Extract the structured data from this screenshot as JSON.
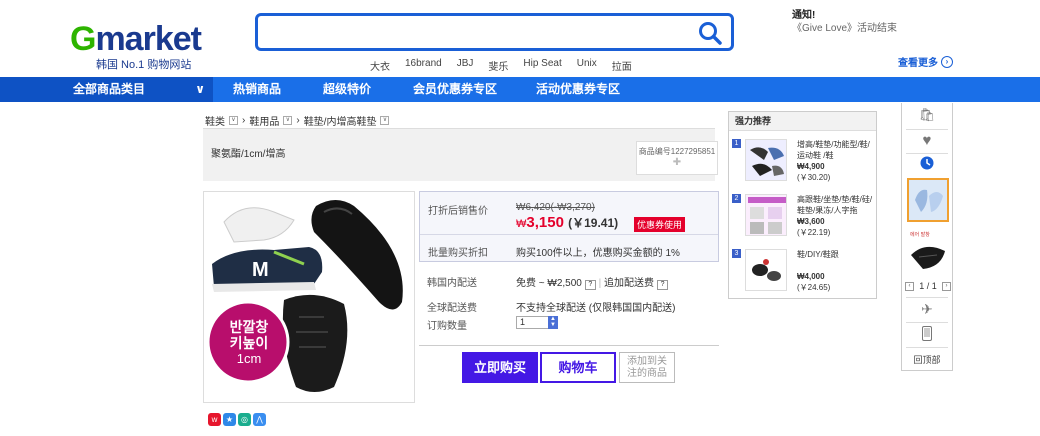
{
  "header": {
    "logo_g": "G",
    "logo_rest": "market",
    "logo_tag": "韩国 No.1 购物网站",
    "search_placeholder": "",
    "keywords": [
      "大衣",
      "16brand",
      "JBJ",
      "斐乐",
      "Hip Seat",
      "Unix",
      "拉面"
    ],
    "notice_title": "通知!",
    "notice_text": "《Give Love》活动结束",
    "more_label": "查看更多"
  },
  "nav": {
    "all_categories": "全部商品类目",
    "items": [
      "热销商品",
      "超级特价",
      "会员优惠券专区",
      "活动优惠券专区"
    ]
  },
  "breadcrumb": [
    "鞋类",
    "鞋用品",
    "鞋垫/内增高鞋垫"
  ],
  "product": {
    "title": "聚氨酯/1cm/增高",
    "code": "商品编号1227295851",
    "image_text_line1": "반깔창",
    "image_text_line2": "키높이",
    "image_text_line3": "1cm",
    "sale_label": "打折后销售价",
    "orig_price": "₩6,420(-₩3,270)",
    "price_w": "₩",
    "price": "3,150",
    "price_cny": "(￥19.41)",
    "coupon": "优惠券使用",
    "bulk_label": "批量购买折扣",
    "bulk_text": "购买100件以上，优惠购买金额的 1%",
    "domestic_label": "韩国内配送",
    "domestic_text": "免费 ~ ₩2,500",
    "domestic_extra": "追加配送费",
    "global_label": "全球配送费",
    "global_text": "不支持全球配送 (仅限韩国国内配送)",
    "qty_label": "订购数量",
    "qty_value": "1",
    "buy_label": "立即购买",
    "cart_label": "购物车",
    "fav_label_1": "添加到关",
    "fav_label_2": "注的商品"
  },
  "recommend": {
    "title": "强力推荐",
    "items": [
      {
        "num": "1",
        "name": "增高/鞋垫/功能型/鞋/运动鞋 /鞋",
        "orig": "",
        "price": "₩4,900",
        "cny": "(￥30.20)"
      },
      {
        "num": "2",
        "name": "高跟鞋/坐垫/垫/鞋/硅/鞋垫/果冻/人字拖",
        "orig": "",
        "price": "₩3,600",
        "cny": "(￥22.19)"
      },
      {
        "num": "3",
        "name": "鞋/DIY/鞋跟",
        "orig": "",
        "price": "₩4,000",
        "cny": "(￥24.65)"
      }
    ]
  },
  "rail": {
    "page": "1 / 1",
    "top_label": "回顶部",
    "thumb_label": "에어 발창"
  },
  "colors": {
    "brand_blue": "#1a6fe8",
    "buy_purple": "#4418e5",
    "price_red": "#e4002b",
    "logo_green": "#2db400"
  }
}
